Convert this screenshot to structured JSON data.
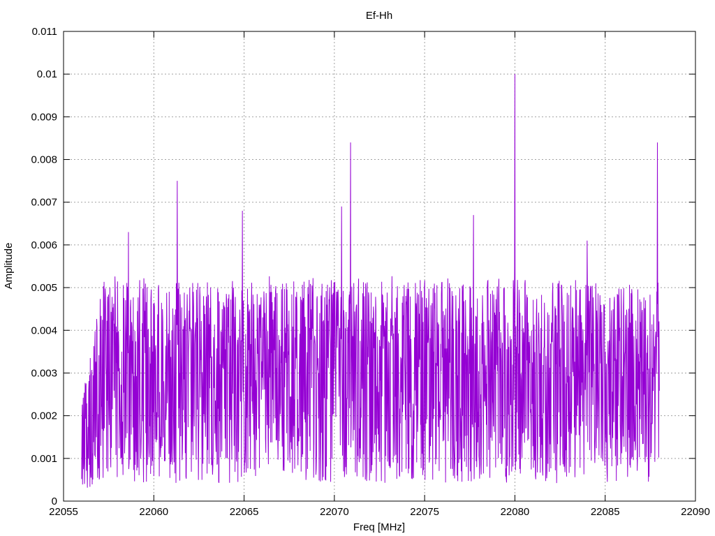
{
  "chart_data": {
    "type": "line",
    "title": "Ef-Hh",
    "xlabel": "Freq [MHz]",
    "ylabel": "Amplitude",
    "xlim": [
      22055,
      22090
    ],
    "ylim": [
      0,
      0.011
    ],
    "xticks": [
      "22055",
      "22060",
      "22065",
      "22070",
      "22075",
      "22080",
      "22085",
      "22090"
    ],
    "yticks": [
      "0",
      "0.001",
      "0.002",
      "0.003",
      "0.004",
      "0.005",
      "0.006",
      "0.007",
      "0.008",
      "0.009",
      "0.01",
      "0.011"
    ],
    "grid": true,
    "legend": "none",
    "series": [
      {
        "color": "#9400d3",
        "x_range": [
          22056.0,
          22088.0
        ],
        "baseline_approx": 0.0028,
        "noise_floor_approx": 0.0005,
        "peaks": [
          {
            "x": 22058.6,
            "y": 0.0063
          },
          {
            "x": 22061.3,
            "y": 0.0075
          },
          {
            "x": 22064.9,
            "y": 0.0068
          },
          {
            "x": 22070.4,
            "y": 0.0069
          },
          {
            "x": 22070.9,
            "y": 0.0084
          },
          {
            "x": 22077.7,
            "y": 0.0067
          },
          {
            "x": 22080.0,
            "y": 0.01
          },
          {
            "x": 22084.0,
            "y": 0.0061
          },
          {
            "x": 22087.9,
            "y": 0.0084
          }
        ]
      }
    ]
  }
}
